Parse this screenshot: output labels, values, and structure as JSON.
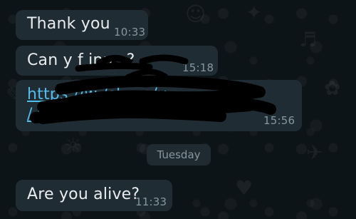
{
  "messages": [
    {
      "text": "Thank you",
      "time": "10:33"
    },
    {
      "text": "Can y      f   inn   s?",
      "time": "15:18"
    },
    {
      "text_line1": "https://w                          /share/v",
      "text_line2": "/                 y      ",
      "time": "15:56"
    },
    {
      "text": "Are you alive?",
      "time": "11:33"
    }
  ],
  "day_separator": "Tuesday",
  "colors": {
    "bubble": "#202c33",
    "link": "#53bdeb",
    "timestamp": "#8696a0",
    "background": "#0d1418"
  }
}
